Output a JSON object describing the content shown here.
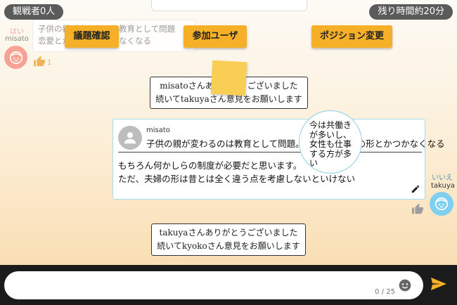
{
  "header": {
    "viewers": "観戦者0人",
    "time_left": "残り時間約20分"
  },
  "toolbar": {
    "topic_button": "議題確認",
    "users_button": "参加ユーザ",
    "position_button": "ポジション変更"
  },
  "left_side": {
    "vote_label": "はい",
    "user_name": "misato",
    "like_count": "1",
    "ghost_line1": "子供の親が変わるのは教育として問題",
    "ghost_line2": "恋愛とか結婚の形とかなくなる"
  },
  "system_messages": [
    {
      "line1": "misatoさんありがとうございました",
      "line2": "続いてtakuyaさん意見をお願いします"
    },
    {
      "line1": "takuyaさんありがとうございました",
      "line2": "続いてkyokoさん意見をお願いします"
    }
  ],
  "main_post": {
    "quoted_user": "misato",
    "quoted_text": "子供の親が変わるのは教育として問題。恋愛とか結婚の形とかつかなくなる",
    "body_line1": "もちろん何かしらの制度が必要だと思います。",
    "body_line2": "ただ、夫婦の形は昔とは全く違う点を考慮しないといけない"
  },
  "thought_bubble": {
    "lines": [
      "今は共働き",
      "が多いし、",
      "女性も仕事",
      "する方が多",
      "い"
    ]
  },
  "right_side": {
    "vote_label": "いいえ",
    "user_name": "takuya"
  },
  "composer": {
    "value": "",
    "placeholder": "",
    "counter": "0 / 25"
  },
  "colors": {
    "accent": "#f5b027",
    "pill_bg": "#5b5b5b",
    "bottom_bar": "#1b1b1b",
    "send": "#f5b027",
    "left_avatar": "#f79a8b",
    "right_avatar": "#7fcff0",
    "card_border": "#a6dbf0"
  },
  "icons": [
    "avatar-face-icon",
    "thumb-up-icon",
    "person-icon",
    "pencil-icon",
    "smiley-icon",
    "send-icon"
  ]
}
